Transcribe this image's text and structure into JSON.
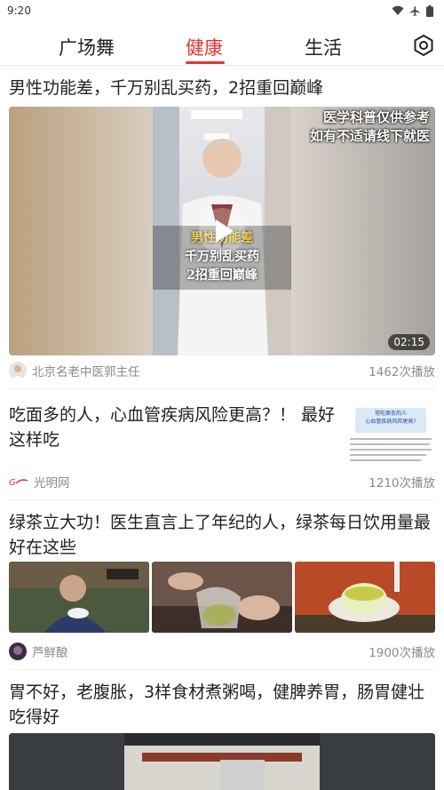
{
  "status_bar": {
    "time": "9:20"
  },
  "tabs": [
    {
      "label": "广场舞"
    },
    {
      "label": "健康"
    },
    {
      "label": "生活"
    }
  ],
  "active_tab": "健康",
  "feed": [
    {
      "title": "男性功能差，千万别乱买药，2招重回巅峰",
      "video": {
        "duration": "02:15",
        "overlay_top": [
          "医学科普仅供参考",
          "如有不适请线下就医"
        ],
        "overlay_center": [
          "男性功能差",
          "千万别乱买药",
          "2招重回巅峰"
        ]
      },
      "source": "北京名老中医郭主任",
      "plays": "1462次播放"
    },
    {
      "title": "吃面多的人，心血管疾病风险更高？！ 最好这样吃",
      "thumb_text": [
        "常吃面条的人",
        "心血管疾病风险更高?"
      ],
      "source": "光明网",
      "plays": "1210次播放"
    },
    {
      "title": "绿茶立大功！医生直言上了年纪的人，绿茶每日饮用量最好在这些",
      "source": "芦鲜酿",
      "plays": "1900次播放"
    },
    {
      "title": "胃不好，老腹胀，3样食材煮粥喝，健脾养胃，肠胃健壮吃得好"
    }
  ]
}
